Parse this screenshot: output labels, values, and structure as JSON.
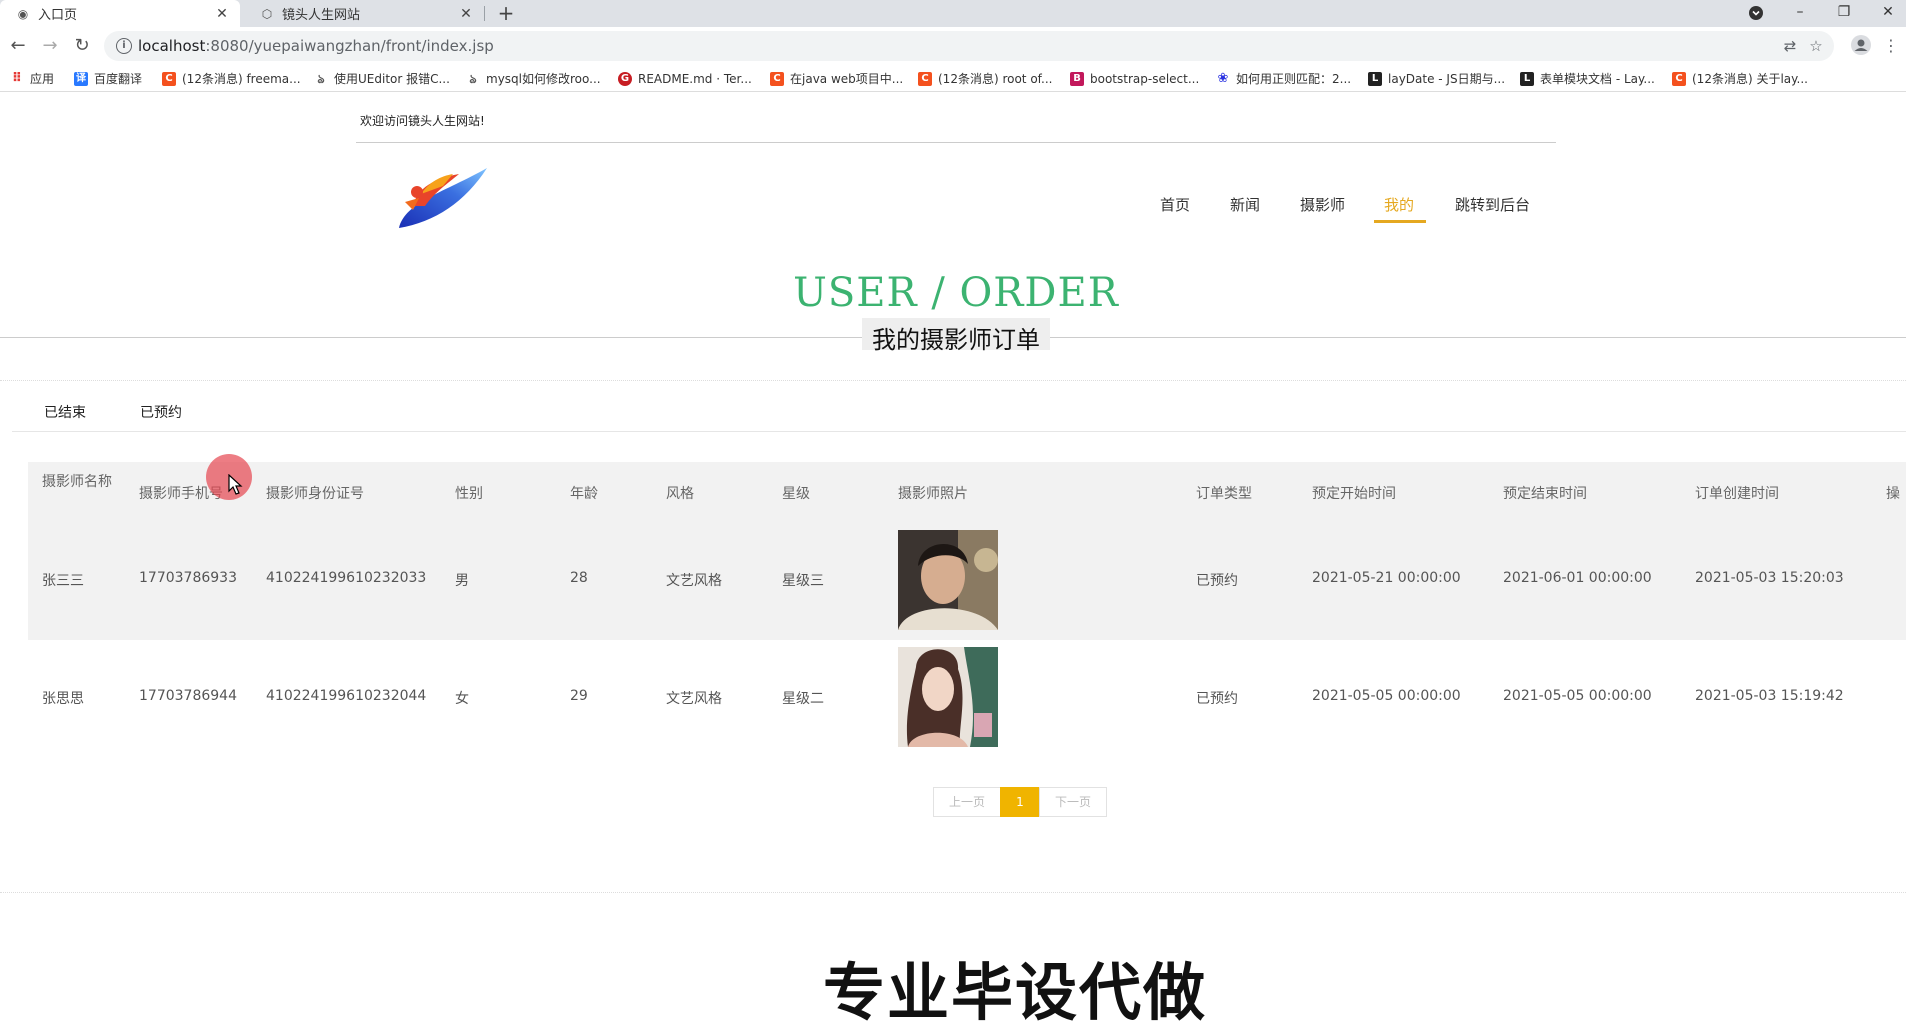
{
  "browser": {
    "tabs": [
      {
        "title": "入口页",
        "active": true
      },
      {
        "title": "镜头人生网站",
        "active": false
      }
    ],
    "url_host": "localhost",
    "url_rest": ":8080/yuepaiwangzhan/front/index.jsp",
    "bookmarks": [
      {
        "label": "应用",
        "icon": "apps-grid-icon",
        "color": "#e53935"
      },
      {
        "label": "百度翻译",
        "icon": "translate-icon",
        "color": "#2979ff"
      },
      {
        "label": "(12条消息) freema...",
        "icon": "csdn-icon",
        "color": "#f4511e"
      },
      {
        "label": "使用UEditor 报错C...",
        "icon": "link-icon",
        "color": "#555"
      },
      {
        "label": "mysql如何修改roo...",
        "icon": "link-icon",
        "color": "#555"
      },
      {
        "label": "README.md · Ter...",
        "icon": "gitee-icon",
        "color": "#c71d23"
      },
      {
        "label": "在java web项目中...",
        "icon": "csdn-icon",
        "color": "#f4511e"
      },
      {
        "label": "(12条消息) root of...",
        "icon": "csdn-icon",
        "color": "#f4511e"
      },
      {
        "label": "bootstrap-select...",
        "icon": "bootstrap-icon",
        "color": "#c2185b"
      },
      {
        "label": "如何用正则匹配：2...",
        "icon": "baidu-icon",
        "color": "#2932e1"
      },
      {
        "label": "layDate - JS日期与...",
        "icon": "layui-icon",
        "color": "#222"
      },
      {
        "label": "表单模块文档 - Lay...",
        "icon": "layui-icon",
        "color": "#222"
      },
      {
        "label": "(12条消息) 关于lay...",
        "icon": "csdn-icon",
        "color": "#f4511e"
      }
    ]
  },
  "site": {
    "welcome": "欢迎访问镜头人生网站!",
    "nav": [
      {
        "label": "首页",
        "active": false
      },
      {
        "label": "新闻",
        "active": false
      },
      {
        "label": "摄影师",
        "active": false
      },
      {
        "label": "我的",
        "active": true
      },
      {
        "label": "跳转到后台",
        "active": false
      }
    ],
    "accent_color": "#e5a820",
    "title_en": "USER / ORDER",
    "title_cn": "我的摄影师订单",
    "title_color": "#3cb371"
  },
  "subtabs": [
    "已结束",
    "已预约"
  ],
  "table": {
    "headers": [
      "摄影师名称",
      "摄影师手机号",
      "摄影师身份证号",
      "性别",
      "年龄",
      "风格",
      "星级",
      "摄影师照片",
      "订单类型",
      "预定开始时间",
      "预定结束时间",
      "订单创建时间",
      "操"
    ],
    "rows": [
      {
        "name": "张三三",
        "phone": "17703786933",
        "id_card": "410224199610232033",
        "gender": "男",
        "age": "28",
        "style": "文艺风格",
        "stars": "星级三",
        "photo": "male-portrait",
        "order_type": "已预约",
        "start": "2021-05-21 00:00:00",
        "end": "2021-06-01 00:00:00",
        "created": "2021-05-03 15:20:03"
      },
      {
        "name": "张思思",
        "phone": "17703786944",
        "id_card": "410224199610232044",
        "gender": "女",
        "age": "29",
        "style": "文艺风格",
        "stars": "星级二",
        "photo": "female-portrait",
        "order_type": "已预约",
        "start": "2021-05-05 00:00:00",
        "end": "2021-05-05 00:00:00",
        "created": "2021-05-03 15:19:42"
      }
    ]
  },
  "pagination": {
    "prev": "上一页",
    "current": "1",
    "next": "下一页"
  },
  "footer_text": "专业毕设代做"
}
